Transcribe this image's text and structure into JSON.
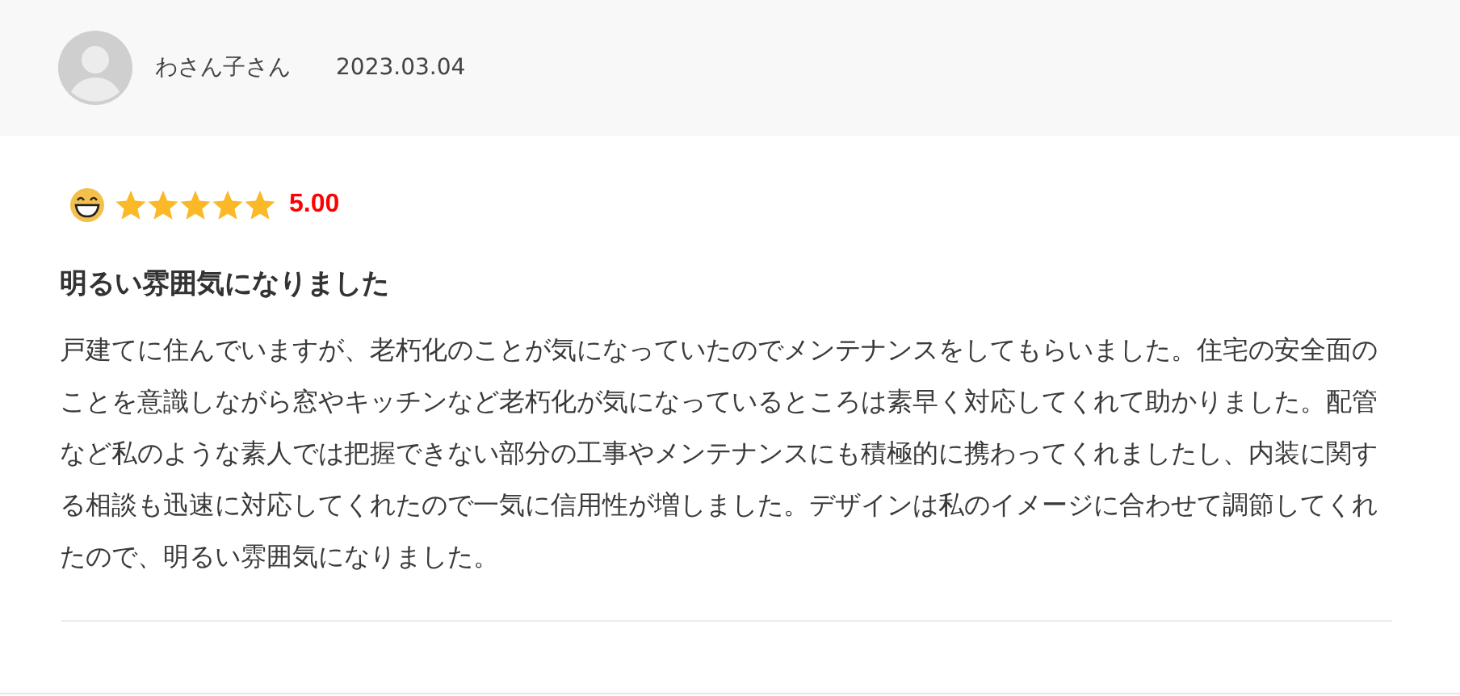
{
  "reviewer": {
    "name": "わさん子さん",
    "date": "2023.03.04"
  },
  "rating": {
    "stars": 5,
    "score": "5.00"
  },
  "review": {
    "title": "明るい雰囲気になりました",
    "body": "戸建てに住んでいますが、老朽化のことが気になっていたのでメンテナンスをしてもらいました。住宅の安全面のことを意識しながら窓やキッチンなど老朽化が気になっているところは素早く対応してくれて助かりました。配管など私のような素人では把握できない部分の工事やメンテナンスにも積極的に携わってくれましたし、内装に関する相談も迅速に対応してくれたので一気に信用性が増しました。デザインは私のイメージに合わせて調節してくれたので、明るい雰囲気になりました。"
  }
}
